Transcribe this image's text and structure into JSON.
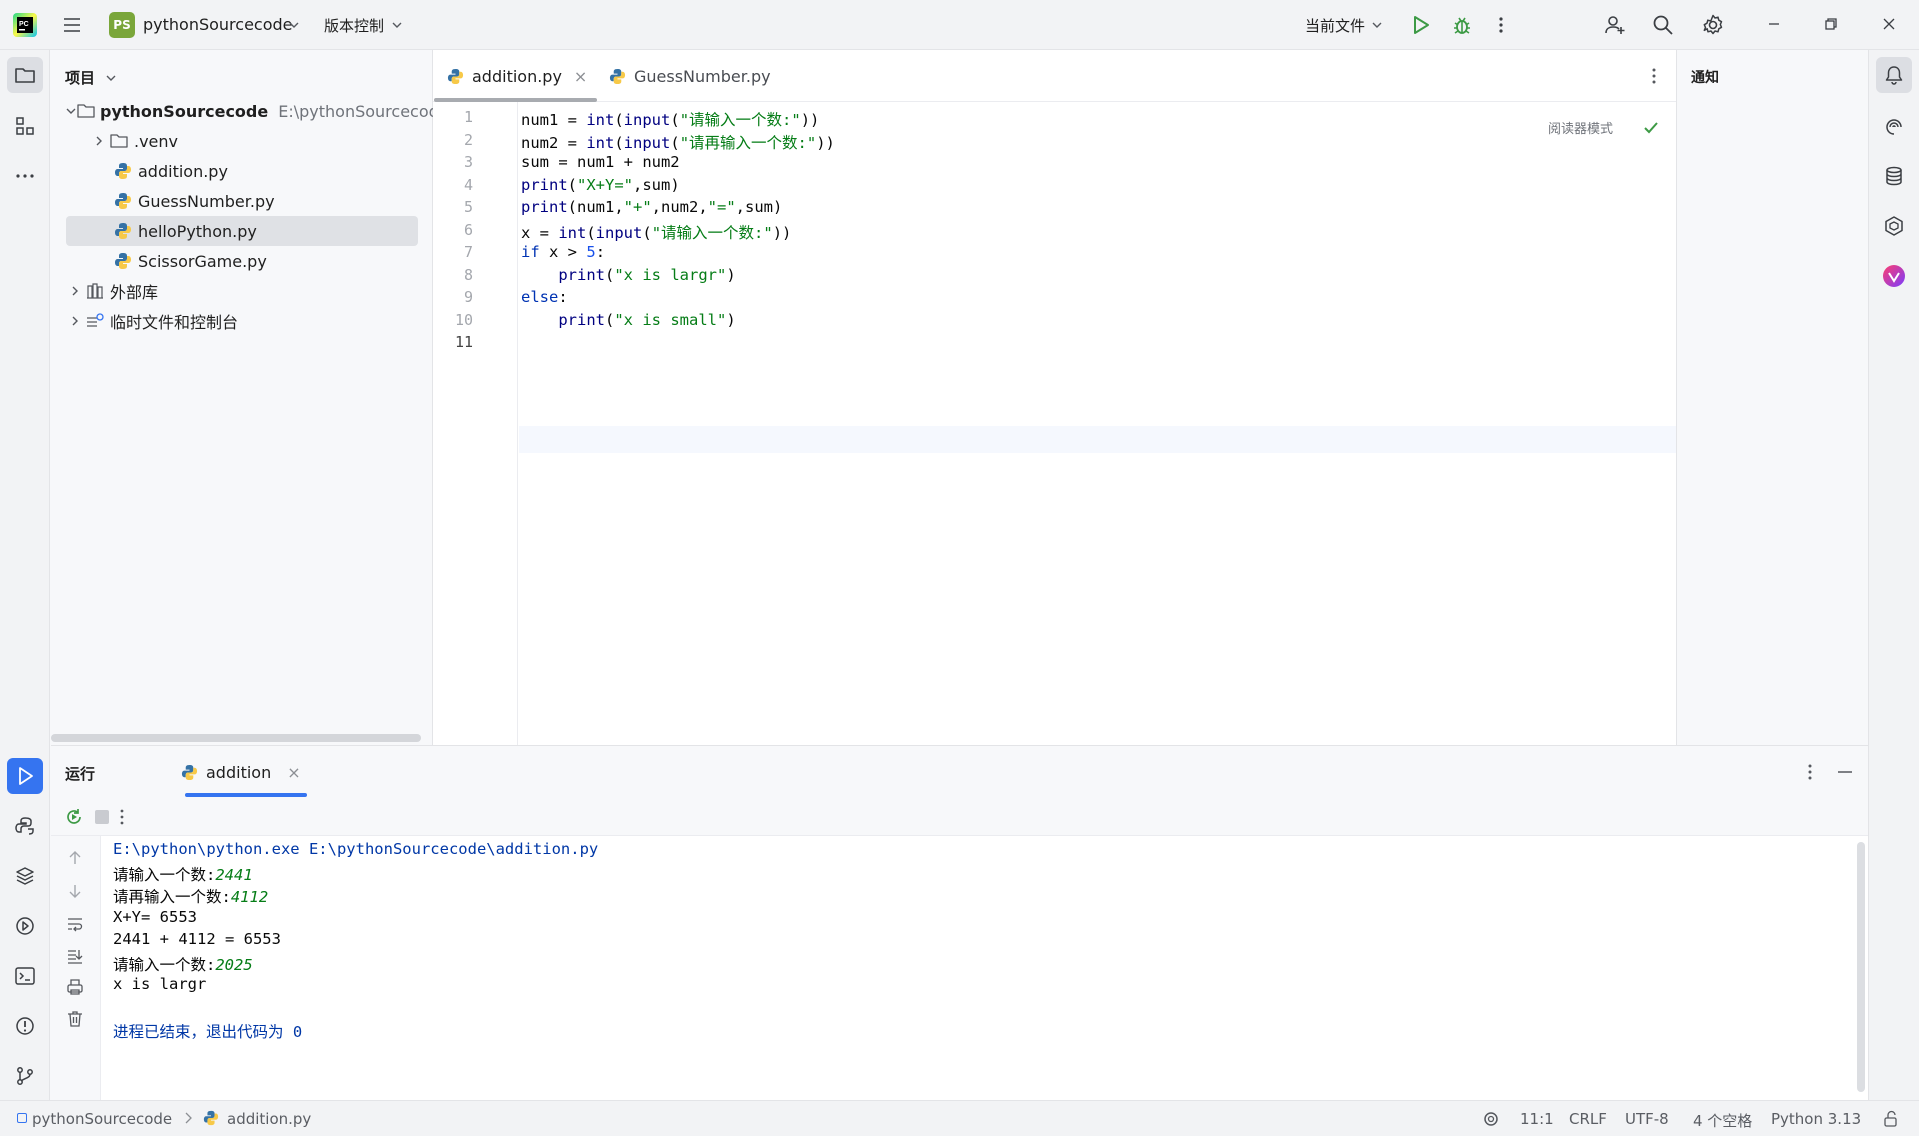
{
  "titlebar": {
    "project_badge": "PS",
    "project_name": "pythonSourcecode",
    "vcs_label": "版本控制",
    "run_config": "当前文件"
  },
  "project_panel": {
    "title": "项目",
    "root": {
      "name": "pythonSourcecode",
      "path": "E:\\pythonSourcecode"
    },
    "items": [
      {
        "label": ".venv"
      },
      {
        "label": "addition.py"
      },
      {
        "label": "GuessNumber.py"
      },
      {
        "label": "helloPython.py"
      },
      {
        "label": "ScissorGame.py"
      },
      {
        "label": "外部库"
      },
      {
        "label": "临时文件和控制台"
      }
    ]
  },
  "editor": {
    "tabs": [
      {
        "label": "addition.py",
        "close": "×"
      },
      {
        "label": "GuessNumber.py"
      }
    ],
    "reader_mode": "阅读器模式",
    "line_numbers": [
      "1",
      "2",
      "3",
      "4",
      "5",
      "6",
      "7",
      "8",
      "9",
      "10",
      "11"
    ],
    "lines": [
      {
        "tokens": [
          [
            "",
            "num1 = "
          ],
          [
            "bi",
            "int"
          ],
          [
            "",
            "("
          ],
          [
            "bi",
            "input"
          ],
          [
            "",
            "("
          ],
          [
            "str",
            "\"请输入一个数:\""
          ],
          [
            "",
            "))"
          ]
        ]
      },
      {
        "tokens": [
          [
            "",
            "num2 = "
          ],
          [
            "bi",
            "int"
          ],
          [
            "",
            "("
          ],
          [
            "bi",
            "input"
          ],
          [
            "",
            "("
          ],
          [
            "str",
            "\"请再输入一个数:\""
          ],
          [
            "",
            "))"
          ]
        ]
      },
      {
        "tokens": [
          [
            "",
            "sum = num1 + num2"
          ]
        ]
      },
      {
        "tokens": [
          [
            "bi",
            "print"
          ],
          [
            "",
            "("
          ],
          [
            "str",
            "\"X+Y=\""
          ],
          [
            "",
            ",sum)"
          ]
        ]
      },
      {
        "tokens": [
          [
            "bi",
            "print"
          ],
          [
            "",
            "(num1,"
          ],
          [
            "str",
            "\"+\""
          ],
          [
            "",
            ",num2,"
          ],
          [
            "str",
            "\"=\""
          ],
          [
            "",
            ",sum)"
          ]
        ]
      },
      {
        "tokens": [
          [
            "",
            "x = "
          ],
          [
            "bi",
            "int"
          ],
          [
            "",
            "("
          ],
          [
            "bi",
            "input"
          ],
          [
            "",
            "("
          ],
          [
            "str",
            "\"请输入一个数:\""
          ],
          [
            "",
            "))"
          ]
        ]
      },
      {
        "tokens": [
          [
            "kw",
            "if"
          ],
          [
            "",
            " x > "
          ],
          [
            "num",
            "5"
          ],
          [
            "",
            ":"
          ]
        ]
      },
      {
        "tokens": [
          [
            "",
            "    "
          ],
          [
            "bi",
            "print"
          ],
          [
            "",
            "("
          ],
          [
            "str",
            "\"x is largr\""
          ],
          [
            "",
            ")"
          ]
        ]
      },
      {
        "tokens": [
          [
            "kw",
            "else"
          ],
          [
            "",
            ":"
          ]
        ]
      },
      {
        "tokens": [
          [
            "",
            "    "
          ],
          [
            "bi",
            "print"
          ],
          [
            "",
            "("
          ],
          [
            "str",
            "\"x is small\""
          ],
          [
            "",
            ")"
          ]
        ]
      },
      {
        "tokens": [
          [
            "",
            ""
          ]
        ]
      }
    ]
  },
  "notifications": {
    "title": "通知"
  },
  "run_panel": {
    "title": "运行",
    "tab_label": "addition",
    "tab_close": "×",
    "console": [
      {
        "text": "E:\\python\\python.exe E:\\pythonSourcecode\\addition.py",
        "input": "",
        "style": "blue"
      },
      {
        "text": "请输入一个数:",
        "input": "2441",
        "style": "normal"
      },
      {
        "text": "请再输入一个数:",
        "input": "4112",
        "style": "normal"
      },
      {
        "text": "X+Y= 6553",
        "input": "",
        "style": "normal"
      },
      {
        "text": "2441 + 4112 = 6553",
        "input": "",
        "style": "normal"
      },
      {
        "text": "请输入一个数:",
        "input": "2025",
        "style": "normal"
      },
      {
        "text": "x is largr",
        "input": "",
        "style": "normal"
      },
      {
        "text": "",
        "input": "",
        "style": "normal"
      },
      {
        "text": "进程已结束，退出代码为 0",
        "input": "",
        "style": "blue"
      }
    ]
  },
  "statusbar": {
    "breadcrumb_project": "pythonSourcecode",
    "breadcrumb_file": "addition.py",
    "position": "11:1",
    "line_ending": "CRLF",
    "encoding": "UTF-8",
    "indent": "4 个空格",
    "interpreter": "Python 3.13"
  },
  "colors": {
    "accent": "#3574f0",
    "keyword": "#0033b3",
    "string": "#067d17",
    "number": "#1750eb",
    "run_green": "#3d9a45",
    "py_blue": "#3572a5",
    "py_yellow": "#f7c948"
  }
}
